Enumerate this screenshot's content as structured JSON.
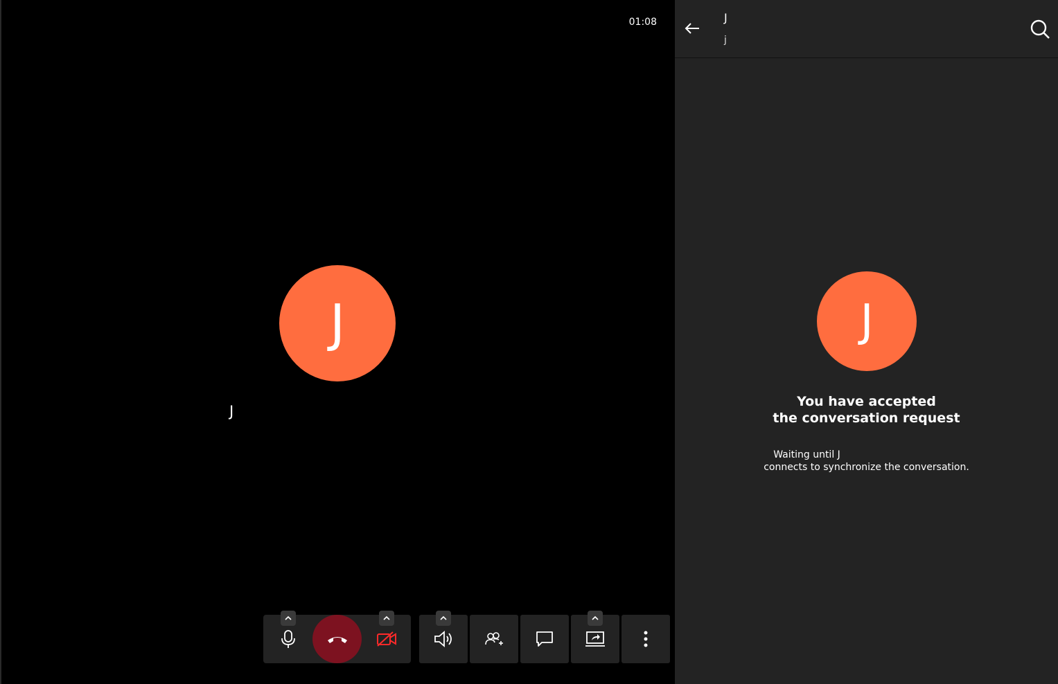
{
  "call": {
    "timer": "01:08",
    "avatar_initial": "J",
    "participant_name": "J"
  },
  "controls": {
    "mic": {
      "icon": "microphone-icon"
    },
    "hangup": {
      "icon": "phone-hangup-icon",
      "color": "#7d1220"
    },
    "camera": {
      "icon": "camera-off-icon",
      "color": "#ff2a2a"
    },
    "speaker": {
      "icon": "speaker-icon"
    },
    "add_participant": {
      "icon": "add-participant-icon"
    },
    "chat": {
      "icon": "chat-bubble-icon"
    },
    "screen_share": {
      "icon": "screen-share-icon"
    },
    "more": {
      "icon": "more-vertical-icon"
    }
  },
  "chat": {
    "title": "J",
    "subtitle": "j",
    "avatar_initial": "J",
    "accepted_line1": "You have accepted",
    "accepted_line2": "the conversation request",
    "waiting_line1": "Waiting until J",
    "waiting_line2": "connects to synchronize the conversation."
  },
  "colors": {
    "avatar": "#ff6d3f",
    "panel_bg": "#232323",
    "call_bg": "#000000"
  }
}
